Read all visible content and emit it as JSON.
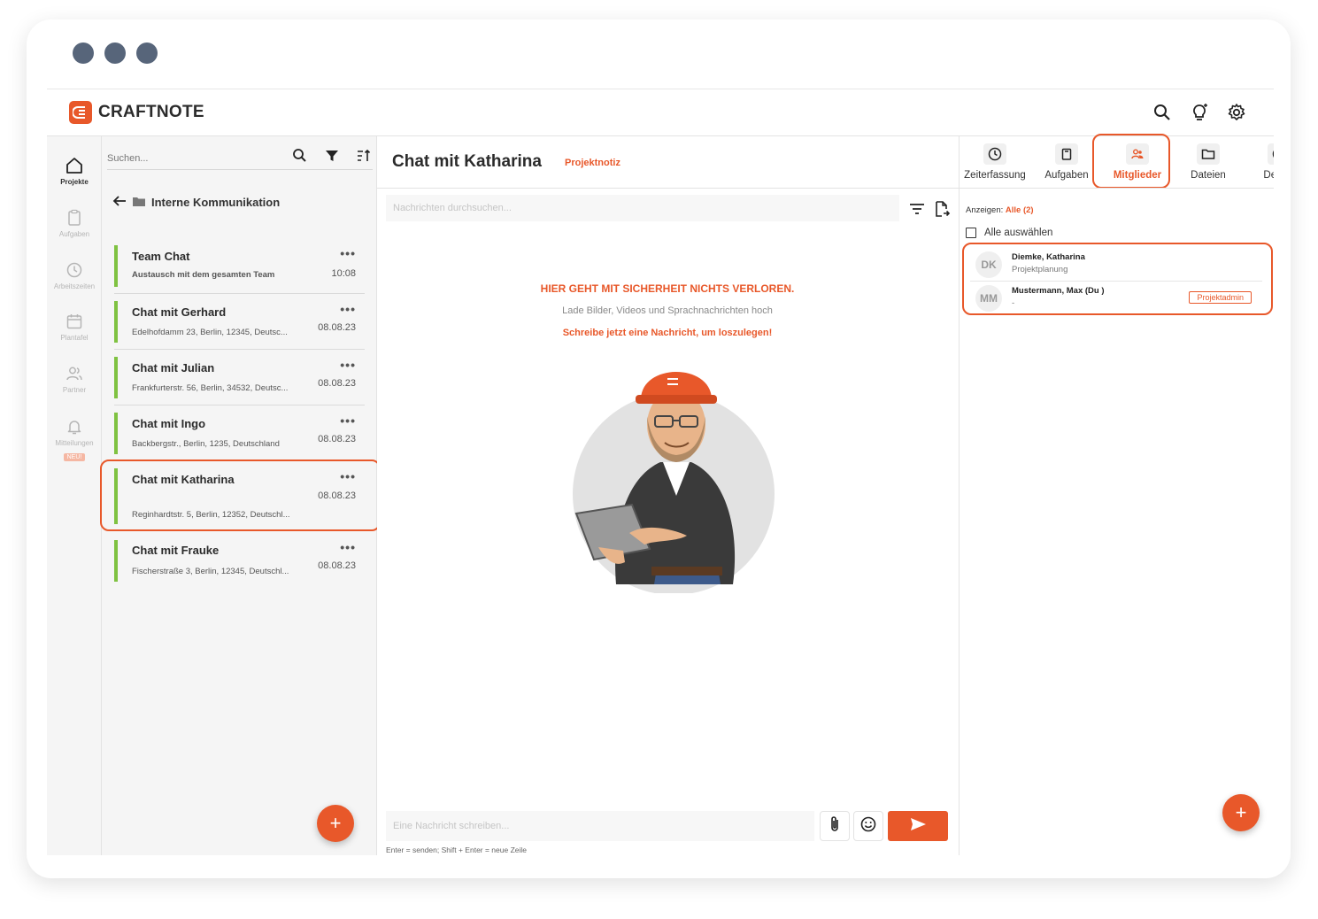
{
  "brand": {
    "name": "CRAFTNOTE",
    "accent": "#e8582a",
    "chat_bar": "#7fc241"
  },
  "rail": [
    {
      "label": "Projekte",
      "icon": "home-icon",
      "active": true
    },
    {
      "label": "Aufgaben",
      "icon": "clipboard-icon"
    },
    {
      "label": "Arbeitszeiten",
      "icon": "clock-icon"
    },
    {
      "label": "Plantafel",
      "icon": "calendar-icon"
    },
    {
      "label": "Partner",
      "icon": "users-icon"
    },
    {
      "label": "Mitteilungen",
      "icon": "bell-icon",
      "badge": "NEU!"
    }
  ],
  "list": {
    "search_placeholder": "Suchen...",
    "folder": "Interne Kommunikation",
    "chats": [
      {
        "title": "Team Chat",
        "sub": "Austausch mit dem gesamten Team",
        "date": "10:08",
        "menu": "•••"
      },
      {
        "title": "Chat mit Gerhard",
        "sub": "Edelhofdamm 23, Berlin, 12345, Deutsc...",
        "date": "08.08.23",
        "menu": "•••"
      },
      {
        "title": "Chat mit Julian",
        "sub": "Frankfurterstr. 56, Berlin, 34532, Deutsc...",
        "date": "08.08.23",
        "menu": "•••"
      },
      {
        "title": "Chat mit Ingo",
        "sub": "Backbergstr., Berlin, 1235, Deutschland",
        "date": "08.08.23",
        "menu": "•••"
      },
      {
        "title": "Chat mit Katharina",
        "sub": "Reginhardtstr. 5, Berlin, 12352, Deutschl...",
        "date": "08.08.23",
        "menu": "•••"
      },
      {
        "title": "Chat mit Frauke",
        "sub": "Fischerstraße 3, Berlin, 12345, Deutschl...",
        "date": "08.08.23",
        "menu": "•••"
      }
    ],
    "fab": "+"
  },
  "main": {
    "title": "Chat mit Katharina",
    "tag": "Projektnotiz",
    "search_placeholder": "Nachrichten durchsuchen...",
    "empty_heading": "HIER GEHT MIT SICHERHEIT NICHTS VERLOREN.",
    "empty_sub": "Lade Bilder, Videos und Sprachnachrichten hoch",
    "empty_cta": "Schreibe jetzt eine Nachricht, um loszulegen!",
    "composer_placeholder": "Eine Nachricht schreiben...",
    "hint": "Enter = senden; Shift + Enter = neue Zeile"
  },
  "tabs": [
    {
      "label": "Zeiterfassung",
      "icon": "clock-icon"
    },
    {
      "label": "Aufgaben",
      "icon": "clipboard-icon"
    },
    {
      "label": "Mitglieder",
      "icon": "members-icon",
      "active": true
    },
    {
      "label": "Dateien",
      "icon": "folder-icon"
    },
    {
      "label": "Details",
      "icon": "info-icon"
    }
  ],
  "members_panel": {
    "show_label": "Anzeigen:",
    "show_value": "Alle (2)",
    "select_all": "Alle auswählen",
    "members": [
      {
        "initials": "DK",
        "name": "Diemke, Katharina",
        "role": "Projektplanung",
        "badge": ""
      },
      {
        "initials": "MM",
        "name": "Mustermann, Max (Du )",
        "role": "-",
        "badge": "Projektadmin"
      }
    ],
    "fab": "+"
  }
}
